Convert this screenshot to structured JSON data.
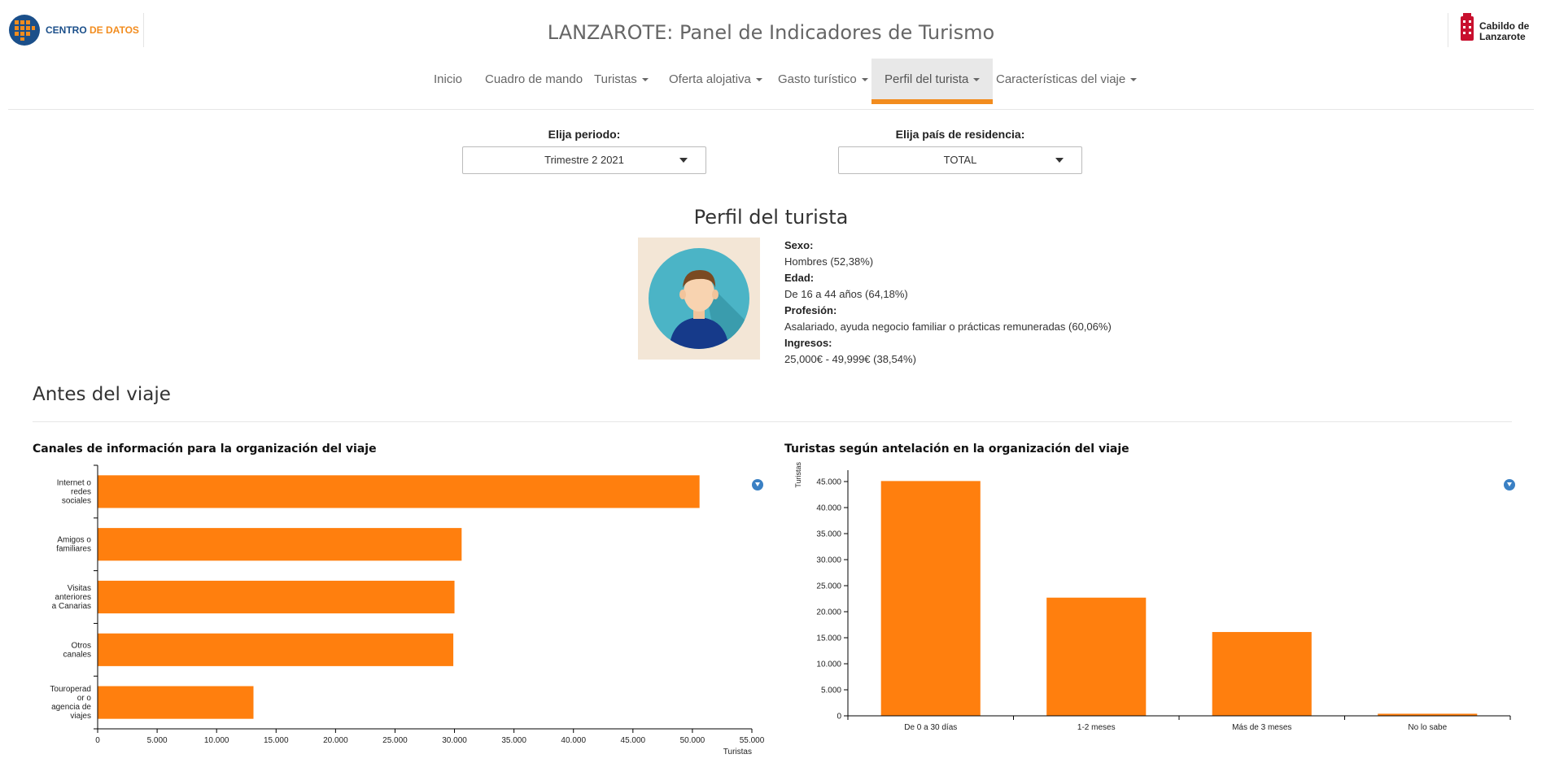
{
  "header": {
    "logo_left": {
      "text_a": "CENTRO",
      "text_b": "DE DATOS"
    },
    "title": "LANZAROTE: Panel de Indicadores de Turismo",
    "logo_right": {
      "line1": "Cabildo de",
      "line2": "Lanzarote"
    }
  },
  "nav": {
    "items": [
      {
        "label": "Inicio",
        "dropdown": false,
        "active": false
      },
      {
        "label": "Cuadro de mando",
        "dropdown": false,
        "active": false
      },
      {
        "label": "Turistas",
        "dropdown": true,
        "active": false
      },
      {
        "label": "Oferta alojativa",
        "dropdown": true,
        "active": false
      },
      {
        "label": "Gasto turístico",
        "dropdown": true,
        "active": false
      },
      {
        "label": "Perfil del turista",
        "dropdown": true,
        "active": true
      },
      {
        "label": "Características del viaje",
        "dropdown": true,
        "active": false
      }
    ]
  },
  "filters": {
    "period": {
      "label": "Elija periodo:",
      "value": "Trimestre 2 2021"
    },
    "country": {
      "label": "Elija país de residencia:",
      "value": "TOTAL"
    }
  },
  "profile": {
    "title": "Perfil del turista",
    "sexo_label": "Sexo:",
    "sexo_value": "Hombres (52,38%)",
    "edad_label": "Edad:",
    "edad_value": "De 16 a 44 años (64,18%)",
    "profesion_label": "Profesión:",
    "profesion_value": "Asalariado, ayuda negocio familiar o prácticas remuneradas (60,06%)",
    "ingresos_label": "Ingresos:",
    "ingresos_value": "25,000€ - 49,999€ (38,54%)"
  },
  "section": {
    "title": "Antes del viaje"
  },
  "colors": {
    "bar": "#ff7f0e",
    "accent": "#f28c1e",
    "download": "#3a80c4"
  },
  "icons": {
    "download": "download-icon",
    "avatar": "user-avatar-icon"
  },
  "chart_data": [
    {
      "type": "bar",
      "orientation": "horizontal",
      "title": "Canales de información para la organización del viaje",
      "categories": [
        [
          "Internet o",
          "redes",
          "sociales"
        ],
        [
          "Amigos o",
          "familiares"
        ],
        [
          "Visitas",
          "anteriores",
          "a Canarias"
        ],
        [
          "Otros",
          "canales"
        ],
        [
          "Touroperad",
          "or o",
          "agencia de",
          "viajes"
        ]
      ],
      "values": [
        50600,
        30600,
        30000,
        29900,
        13100
      ],
      "xlabel": "Turistas",
      "xlim": [
        0,
        55000
      ],
      "ticks": [
        0,
        5000,
        10000,
        15000,
        20000,
        25000,
        30000,
        35000,
        40000,
        45000,
        50000,
        55000
      ],
      "tick_labels": [
        "0",
        "5.000",
        "10.000",
        "15.000",
        "20.000",
        "25.000",
        "30.000",
        "35.000",
        "40.000",
        "45.000",
        "50.000",
        "55.000"
      ]
    },
    {
      "type": "bar",
      "orientation": "vertical",
      "title": "Turistas según antelación en la organización del viaje",
      "categories": [
        "De 0 a 30 días",
        "1-2 meses",
        "Más de 3 meses",
        "No lo sabe"
      ],
      "values": [
        45100,
        22700,
        16100,
        400
      ],
      "ylabel": "Turistas",
      "ylim": [
        0,
        45000
      ],
      "ticks": [
        0,
        5000,
        10000,
        15000,
        20000,
        25000,
        30000,
        35000,
        40000,
        45000
      ],
      "tick_labels": [
        "0",
        "5.000",
        "10.000",
        "15.000",
        "20.000",
        "25.000",
        "30.000",
        "35.000",
        "40.000",
        "45.000"
      ]
    }
  ]
}
